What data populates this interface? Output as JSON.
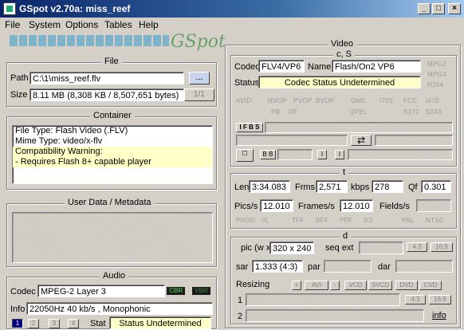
{
  "window": {
    "title": "GSpot v2.70a: miss_reef"
  },
  "menu": [
    "File",
    "System",
    "Options",
    "Tables",
    "Help"
  ],
  "logo": "GSpot",
  "file": {
    "title": "File",
    "path_label": "Path",
    "path_value": "C:\\1\\miss_reef.flv",
    "browse_label": "...",
    "size_label": "Size",
    "size_value": "8.11 MB (8,308 KB / 8,507,651 bytes)",
    "page": "1/1"
  },
  "container": {
    "title": "Container",
    "lines": [
      "File Type: Flash Video (.FLV)",
      "Mime Type: video/x-flv",
      "Compatibility Warning:",
      "- Requires Flash 8+ capable player"
    ]
  },
  "user_data": {
    "title": "User Data / Metadata"
  },
  "audio": {
    "title": "Audio",
    "codec_label": "Codec",
    "codec_value": "MPEG-2 Layer 3",
    "cbr": "CBR",
    "vbr": "VBR",
    "info_label": "Info",
    "info_value": "22050Hz  40 kb/s , Monophonic",
    "streams": [
      "1",
      "2",
      "3",
      "4"
    ],
    "stat_label": "Stat",
    "stat_value": "Status Undetermined"
  },
  "video": {
    "title": "Video",
    "cs_title": "c, S",
    "codec_label": "Codec",
    "codec_value": "FLV4/VP6",
    "name_label": "Name",
    "name_value": "Flash/On2 VP6",
    "status_label": "Status",
    "status_value": "Codec Status Undetermined",
    "tags_right": [
      "MPG2",
      "MPG4",
      "H264"
    ],
    "tags_row": [
      "AVID",
      "NVOP",
      "PVOP",
      "BVOP",
      "GMC",
      "I703",
      "FCC",
      "I470"
    ],
    "tags_row2": [
      "PB",
      "DF",
      "QPEL",
      "S170",
      "S240"
    ],
    "ifbs": "I F B S",
    "bb": "B B",
    "ii": "I",
    "t_title": "t",
    "len_label": "Len",
    "len_value": "3:34.083",
    "frms_label": "Frms",
    "frms_value": "2,571",
    "kbps_label": "kbps",
    "kbps_value": "278",
    "qf_label": "Qf",
    "qf_value": "0.301",
    "pics_label": "Pics/s",
    "pics_value": "12.010",
    "frames_label": "Frames/s",
    "frames_value": "12.010",
    "fields_label": "Fields/s",
    "fmt_tags": [
      "PROG",
      "I/L",
      "TFF",
      "BFF",
      "PPF",
      "3:2",
      "PAL",
      "NTSC"
    ],
    "d_title": "d",
    "pic_label": "pic (w x",
    "pic_value": "320 x 240",
    "seqext_label": "seq ext",
    "ar43": "4:3",
    "ar169": "16:9",
    "sar_label": "sar",
    "sar_value": "1.333 (4:3)",
    "par_label": "par",
    "dar_label": "dar",
    "resizing_label": "Resizing",
    "resize_btns": [
      "+",
      "AVI",
      "-",
      "VCD",
      "SVCD",
      "DVD",
      "CVD"
    ],
    "row1": "1",
    "row2": "2",
    "r43": "4:3",
    "r169": "16:9",
    "info_link": "info"
  }
}
